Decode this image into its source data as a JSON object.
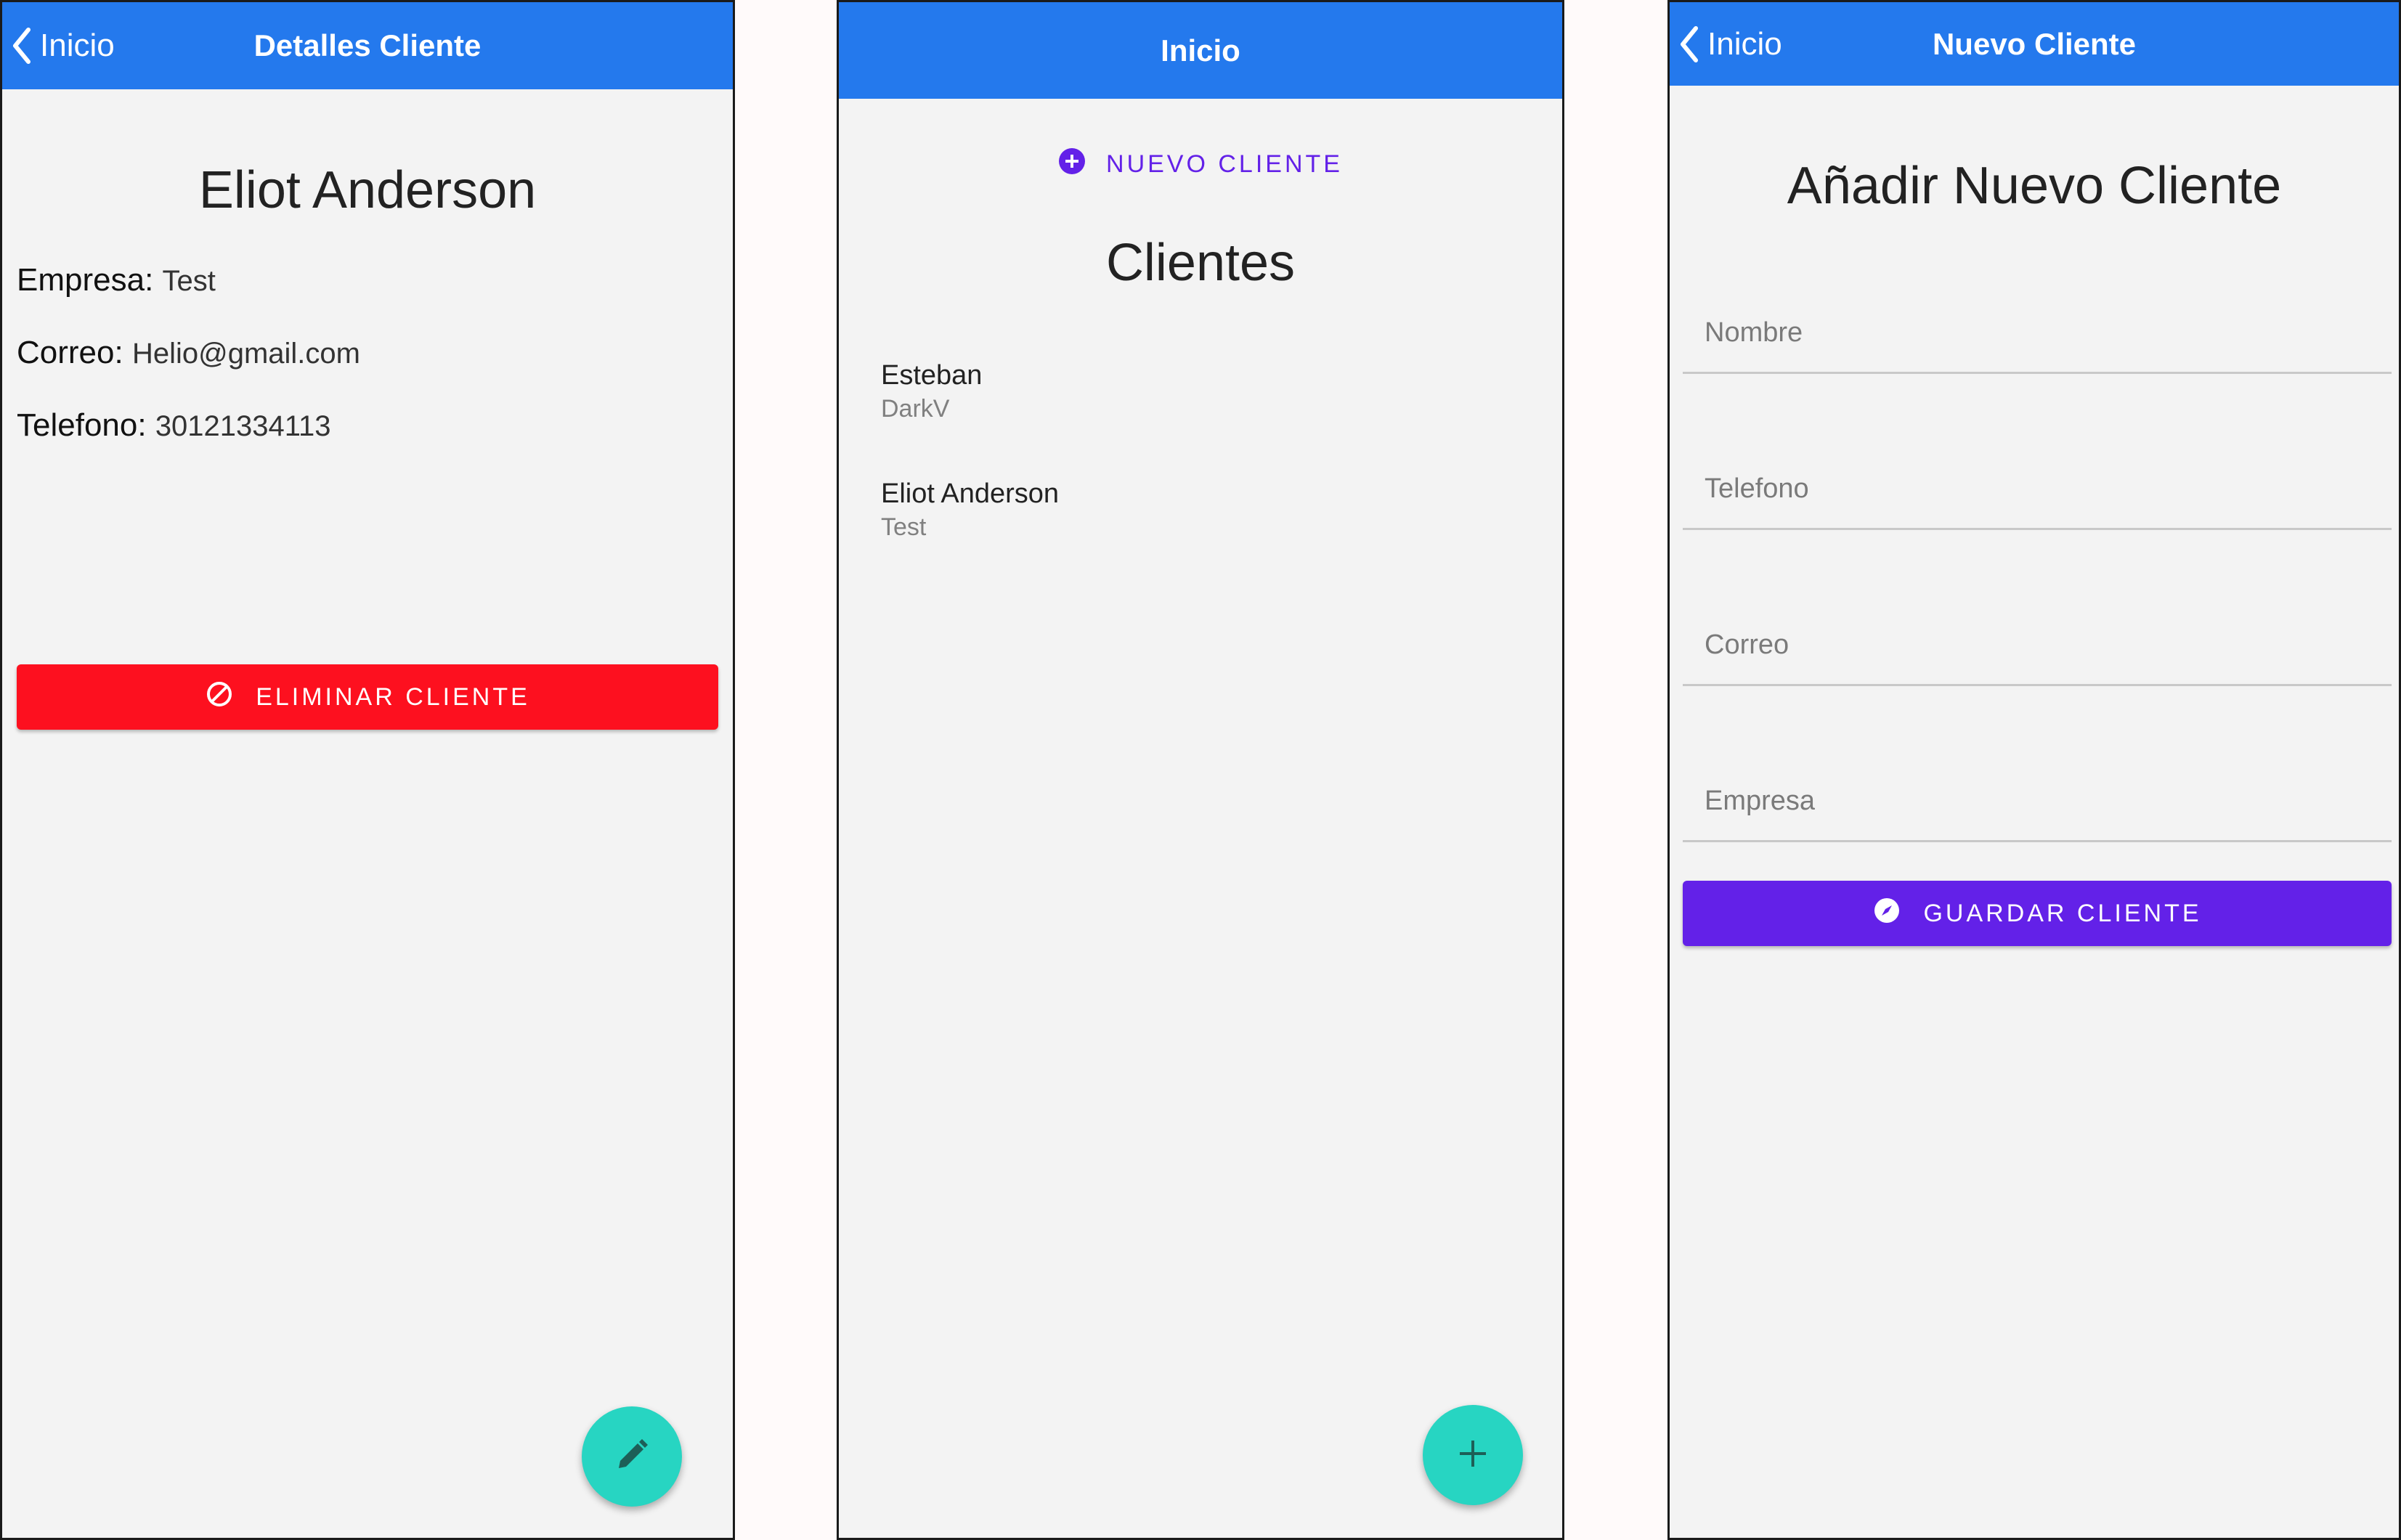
{
  "detail_screen": {
    "nav": {
      "back_label": "Inicio",
      "title": "Detalles Cliente"
    },
    "client_name": "Eliot Anderson",
    "fields": [
      {
        "label": "Empresa:",
        "value": "Test"
      },
      {
        "label": "Correo:",
        "value": "Helio@gmail.com"
      },
      {
        "label": "Telefono:",
        "value": "30121334113"
      }
    ],
    "delete_button": {
      "label": "ELIMINAR CLIENTE",
      "icon": "block-icon"
    },
    "fab": {
      "icon": "pencil-icon"
    }
  },
  "home_screen": {
    "nav": {
      "title": "Inicio"
    },
    "new_client_link": {
      "label": "NUEVO CLIENTE",
      "icon": "plus-circle-icon"
    },
    "title": "Clientes",
    "clients": [
      {
        "name": "Esteban",
        "company": "DarkV"
      },
      {
        "name": "Eliot Anderson",
        "company": "Test"
      }
    ],
    "fab": {
      "icon": "plus-icon"
    }
  },
  "new_screen": {
    "nav": {
      "back_label": "Inicio",
      "title": "Nuevo Cliente"
    },
    "title": "Añadir Nuevo Cliente",
    "inputs": [
      {
        "placeholder": "Nombre",
        "value": ""
      },
      {
        "placeholder": "Telefono",
        "value": ""
      },
      {
        "placeholder": "Correo",
        "value": ""
      },
      {
        "placeholder": "Empresa",
        "value": ""
      }
    ],
    "save_button": {
      "label": "GUARDAR CLIENTE",
      "icon": "compass-icon"
    }
  },
  "colors": {
    "navbar": "#2479ed",
    "background": "#f3f3f3",
    "delete": "#fd101f",
    "primary": "#6321e8",
    "fab": "#27d5c2"
  }
}
